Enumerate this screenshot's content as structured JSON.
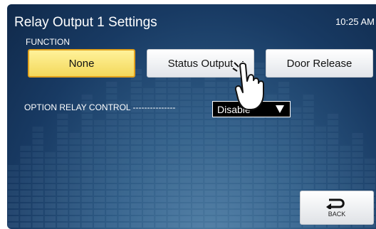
{
  "header": {
    "title": "Relay Output 1 Settings",
    "time": "10:25 AM"
  },
  "function": {
    "label": "FUNCTION",
    "options": [
      "None",
      "Status Output",
      "Door Release"
    ],
    "selected": "None"
  },
  "option_relay": {
    "label": "OPTION RELAY CONTROL ---------------",
    "value": "Disable"
  },
  "back": {
    "label": "BACK"
  },
  "colors": {
    "selected_fill": "#f6de6c",
    "selected_border": "#e2a21e",
    "background": "#183a63"
  },
  "icons": {
    "pointer": "hand-pointer-icon",
    "back": "back-arrow-icon",
    "dropdown": "triangle-down-icon"
  }
}
